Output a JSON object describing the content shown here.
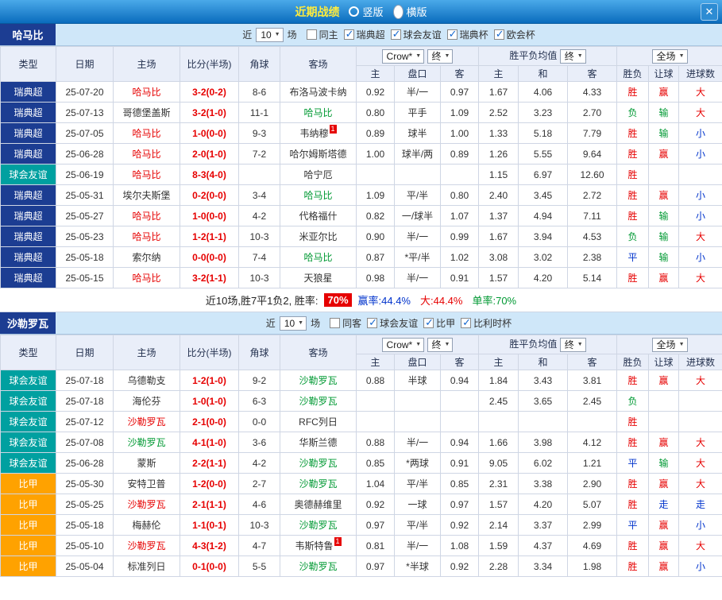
{
  "colors": {
    "red": "#e60000",
    "green": "#009933",
    "blue": "#0033cc",
    "black": "#333333",
    "league_sweden": "#1c3d92",
    "league_friendly": "#00a0a0",
    "league_belgium": "#ffa200"
  },
  "titlebar": {
    "title": "近期战绩",
    "layout_vertical": "竖版",
    "layout_horizontal": "横版",
    "close": "✕"
  },
  "filter_labels": {
    "near": "近",
    "unit": "场"
  },
  "columns": {
    "type": "类型",
    "date": "日期",
    "home": "主场",
    "score": "比分(半场)",
    "corner": "角球",
    "away": "客场",
    "odds_home": "主",
    "odds_line": "盘口",
    "odds_away": "客",
    "avg_home": "主",
    "avg_draw": "和",
    "avg_away": "客",
    "wdl": "胜负",
    "handicap": "让球",
    "goals": "进球数",
    "bookmaker": "Crow*",
    "final": "终",
    "avg_label": "胜平负均值",
    "scope": "全场"
  },
  "sections": [
    {
      "team": "哈马比",
      "filter": {
        "count": "10",
        "checkboxes": [
          {
            "label": "同主",
            "checked": false
          },
          {
            "label": "瑞典超",
            "checked": true
          },
          {
            "label": "球会友谊",
            "checked": true
          },
          {
            "label": "瑞典杯",
            "checked": true
          },
          {
            "label": "欧会杯",
            "checked": true
          }
        ]
      },
      "rows": [
        {
          "league": "瑞典超",
          "league_color": "league_sweden",
          "date": "25-07-20",
          "home": {
            "text": "哈马比",
            "color": "red"
          },
          "score": "3-2(0-2)",
          "corner": "8-6",
          "away": {
            "text": "布洛马波卡纳",
            "color": "black"
          },
          "odds": [
            "0.92",
            "半/一",
            "0.97"
          ],
          "avg": [
            "1.67",
            "4.06",
            "4.33"
          ],
          "results": [
            {
              "t": "胜",
              "c": "red"
            },
            {
              "t": "赢",
              "c": "red"
            },
            {
              "t": "大",
              "c": "red"
            }
          ]
        },
        {
          "league": "瑞典超",
          "league_color": "league_sweden",
          "date": "25-07-13",
          "home": {
            "text": "哥德堡盖斯",
            "color": "black"
          },
          "score": "3-2(1-0)",
          "corner": "11-1",
          "away": {
            "text": "哈马比",
            "color": "green"
          },
          "odds": [
            "0.80",
            "平手",
            "1.09"
          ],
          "avg": [
            "2.52",
            "3.23",
            "2.70"
          ],
          "results": [
            {
              "t": "负",
              "c": "green"
            },
            {
              "t": "输",
              "c": "green"
            },
            {
              "t": "大",
              "c": "red"
            }
          ]
        },
        {
          "league": "瑞典超",
          "league_color": "league_sweden",
          "date": "25-07-05",
          "home": {
            "text": "哈马比",
            "color": "red"
          },
          "score": "1-0(0-0)",
          "corner": "9-3",
          "away": {
            "text": "韦纳穆",
            "color": "black",
            "badge": "1"
          },
          "odds": [
            "0.89",
            "球半",
            "1.00"
          ],
          "avg": [
            "1.33",
            "5.18",
            "7.79"
          ],
          "results": [
            {
              "t": "胜",
              "c": "red"
            },
            {
              "t": "输",
              "c": "green"
            },
            {
              "t": "小",
              "c": "blue"
            }
          ]
        },
        {
          "league": "瑞典超",
          "league_color": "league_sweden",
          "date": "25-06-28",
          "home": {
            "text": "哈马比",
            "color": "red"
          },
          "score": "2-0(1-0)",
          "corner": "7-2",
          "away": {
            "text": "哈尔姆斯塔德",
            "color": "black"
          },
          "odds": [
            "1.00",
            "球半/两",
            "0.89"
          ],
          "avg": [
            "1.26",
            "5.55",
            "9.64"
          ],
          "results": [
            {
              "t": "胜",
              "c": "red"
            },
            {
              "t": "赢",
              "c": "red"
            },
            {
              "t": "小",
              "c": "blue"
            }
          ]
        },
        {
          "league": "球会友谊",
          "league_color": "league_friendly",
          "date": "25-06-19",
          "home": {
            "text": "哈马比",
            "color": "red"
          },
          "score": "8-3(4-0)",
          "corner": "",
          "away": {
            "text": "哈宁厄",
            "color": "black"
          },
          "odds": [
            "",
            "",
            ""
          ],
          "avg": [
            "1.15",
            "6.97",
            "12.60"
          ],
          "results": [
            {
              "t": "胜",
              "c": "red"
            },
            {
              "t": "",
              "c": "black"
            },
            {
              "t": "",
              "c": "black"
            }
          ]
        },
        {
          "league": "瑞典超",
          "league_color": "league_sweden",
          "date": "25-05-31",
          "home": {
            "text": "埃尔夫斯堡",
            "color": "black"
          },
          "score": "0-2(0-0)",
          "corner": "3-4",
          "away": {
            "text": "哈马比",
            "color": "green"
          },
          "odds": [
            "1.09",
            "平/半",
            "0.80"
          ],
          "avg": [
            "2.40",
            "3.45",
            "2.72"
          ],
          "results": [
            {
              "t": "胜",
              "c": "red"
            },
            {
              "t": "赢",
              "c": "red"
            },
            {
              "t": "小",
              "c": "blue"
            }
          ]
        },
        {
          "league": "瑞典超",
          "league_color": "league_sweden",
          "date": "25-05-27",
          "home": {
            "text": "哈马比",
            "color": "red"
          },
          "score": "1-0(0-0)",
          "corner": "4-2",
          "away": {
            "text": "代格福什",
            "color": "black"
          },
          "odds": [
            "0.82",
            "一/球半",
            "1.07"
          ],
          "avg": [
            "1.37",
            "4.94",
            "7.11"
          ],
          "results": [
            {
              "t": "胜",
              "c": "red"
            },
            {
              "t": "输",
              "c": "green"
            },
            {
              "t": "小",
              "c": "blue"
            }
          ]
        },
        {
          "league": "瑞典超",
          "league_color": "league_sweden",
          "date": "25-05-23",
          "home": {
            "text": "哈马比",
            "color": "red"
          },
          "score": "1-2(1-1)",
          "corner": "10-3",
          "away": {
            "text": "米亚尔比",
            "color": "black"
          },
          "odds": [
            "0.90",
            "半/一",
            "0.99"
          ],
          "avg": [
            "1.67",
            "3.94",
            "4.53"
          ],
          "results": [
            {
              "t": "负",
              "c": "green"
            },
            {
              "t": "输",
              "c": "green"
            },
            {
              "t": "大",
              "c": "red"
            }
          ]
        },
        {
          "league": "瑞典超",
          "league_color": "league_sweden",
          "date": "25-05-18",
          "home": {
            "text": "索尔纳",
            "color": "black"
          },
          "score": "0-0(0-0)",
          "corner": "7-4",
          "away": {
            "text": "哈马比",
            "color": "green"
          },
          "odds": [
            "0.87",
            "*平/半",
            "1.02"
          ],
          "avg": [
            "3.08",
            "3.02",
            "2.38"
          ],
          "results": [
            {
              "t": "平",
              "c": "blue"
            },
            {
              "t": "输",
              "c": "green"
            },
            {
              "t": "小",
              "c": "blue"
            }
          ]
        },
        {
          "league": "瑞典超",
          "league_color": "league_sweden",
          "date": "25-05-15",
          "home": {
            "text": "哈马比",
            "color": "red"
          },
          "score": "3-2(1-1)",
          "corner": "10-3",
          "away": {
            "text": "天狼星",
            "color": "black"
          },
          "odds": [
            "0.98",
            "半/一",
            "0.91"
          ],
          "avg": [
            "1.57",
            "4.20",
            "5.14"
          ],
          "results": [
            {
              "t": "胜",
              "c": "red"
            },
            {
              "t": "赢",
              "c": "red"
            },
            {
              "t": "大",
              "c": "red"
            }
          ]
        }
      ],
      "summary": {
        "prefix": "近10场,胜7平1负2, 胜率:",
        "rate": "70%",
        "stats": [
          {
            "text": "赢率:44.4%",
            "color": "blue"
          },
          {
            "text": "大:44.4%",
            "color": "red"
          },
          {
            "text": "单率:70%",
            "color": "green"
          }
        ]
      }
    },
    {
      "team": "沙勒罗瓦",
      "filter": {
        "count": "10",
        "checkboxes": [
          {
            "label": "同客",
            "checked": false
          },
          {
            "label": "球会友谊",
            "checked": true
          },
          {
            "label": "比甲",
            "checked": true
          },
          {
            "label": "比利时杯",
            "checked": true
          }
        ]
      },
      "rows": [
        {
          "league": "球会友谊",
          "league_color": "league_friendly",
          "date": "25-07-18",
          "home": {
            "text": "乌德勒支",
            "color": "black"
          },
          "score": "1-2(1-0)",
          "corner": "9-2",
          "away": {
            "text": "沙勒罗瓦",
            "color": "green"
          },
          "odds": [
            "0.88",
            "半球",
            "0.94"
          ],
          "avg": [
            "1.84",
            "3.43",
            "3.81"
          ],
          "results": [
            {
              "t": "胜",
              "c": "red"
            },
            {
              "t": "赢",
              "c": "red"
            },
            {
              "t": "大",
              "c": "red"
            }
          ]
        },
        {
          "league": "球会友谊",
          "league_color": "league_friendly",
          "date": "25-07-18",
          "home": {
            "text": "海伦芬",
            "color": "black"
          },
          "score": "1-0(1-0)",
          "corner": "6-3",
          "away": {
            "text": "沙勒罗瓦",
            "color": "green"
          },
          "odds": [
            "",
            "",
            ""
          ],
          "avg": [
            "2.45",
            "3.65",
            "2.45"
          ],
          "results": [
            {
              "t": "负",
              "c": "green"
            },
            {
              "t": "",
              "c": "black"
            },
            {
              "t": "",
              "c": "black"
            }
          ]
        },
        {
          "league": "球会友谊",
          "league_color": "league_friendly",
          "date": "25-07-12",
          "home": {
            "text": "沙勒罗瓦",
            "color": "red"
          },
          "score": "2-1(0-0)",
          "corner": "0-0",
          "away": {
            "text": "RFC列日",
            "color": "black"
          },
          "odds": [
            "",
            "",
            ""
          ],
          "avg": [
            "",
            "",
            ""
          ],
          "results": [
            {
              "t": "胜",
              "c": "red"
            },
            {
              "t": "",
              "c": "black"
            },
            {
              "t": "",
              "c": "black"
            }
          ]
        },
        {
          "league": "球会友谊",
          "league_color": "league_friendly",
          "date": "25-07-08",
          "home": {
            "text": "沙勒罗瓦",
            "color": "green"
          },
          "score": "4-1(1-0)",
          "corner": "3-6",
          "away": {
            "text": "华斯兰德",
            "color": "black"
          },
          "odds": [
            "0.88",
            "半/一",
            "0.94"
          ],
          "avg": [
            "1.66",
            "3.98",
            "4.12"
          ],
          "results": [
            {
              "t": "胜",
              "c": "red"
            },
            {
              "t": "赢",
              "c": "red"
            },
            {
              "t": "大",
              "c": "red"
            }
          ]
        },
        {
          "league": "球会友谊",
          "league_color": "league_friendly",
          "date": "25-06-28",
          "home": {
            "text": "蒙斯",
            "color": "black"
          },
          "score": "2-2(1-1)",
          "corner": "4-2",
          "away": {
            "text": "沙勒罗瓦",
            "color": "green"
          },
          "odds": [
            "0.85",
            "*两球",
            "0.91"
          ],
          "avg": [
            "9.05",
            "6.02",
            "1.21"
          ],
          "results": [
            {
              "t": "平",
              "c": "blue"
            },
            {
              "t": "输",
              "c": "green"
            },
            {
              "t": "大",
              "c": "red"
            }
          ]
        },
        {
          "league": "比甲",
          "league_color": "league_belgium",
          "date": "25-05-30",
          "home": {
            "text": "安特卫普",
            "color": "black"
          },
          "score": "1-2(0-0)",
          "corner": "2-7",
          "away": {
            "text": "沙勒罗瓦",
            "color": "green"
          },
          "odds": [
            "1.04",
            "平/半",
            "0.85"
          ],
          "avg": [
            "2.31",
            "3.38",
            "2.90"
          ],
          "results": [
            {
              "t": "胜",
              "c": "red"
            },
            {
              "t": "赢",
              "c": "red"
            },
            {
              "t": "大",
              "c": "red"
            }
          ]
        },
        {
          "league": "比甲",
          "league_color": "league_belgium",
          "date": "25-05-25",
          "home": {
            "text": "沙勒罗瓦",
            "color": "red"
          },
          "score": "2-1(1-1)",
          "corner": "4-6",
          "away": {
            "text": "奥德赫维里",
            "color": "black"
          },
          "odds": [
            "0.92",
            "一球",
            "0.97"
          ],
          "avg": [
            "1.57",
            "4.20",
            "5.07"
          ],
          "results": [
            {
              "t": "胜",
              "c": "red"
            },
            {
              "t": "走",
              "c": "blue"
            },
            {
              "t": "走",
              "c": "blue"
            }
          ]
        },
        {
          "league": "比甲",
          "league_color": "league_belgium",
          "date": "25-05-18",
          "home": {
            "text": "梅赫伦",
            "color": "black"
          },
          "score": "1-1(0-1)",
          "corner": "10-3",
          "away": {
            "text": "沙勒罗瓦",
            "color": "green"
          },
          "odds": [
            "0.97",
            "平/半",
            "0.92"
          ],
          "avg": [
            "2.14",
            "3.37",
            "2.99"
          ],
          "results": [
            {
              "t": "平",
              "c": "blue"
            },
            {
              "t": "赢",
              "c": "red"
            },
            {
              "t": "小",
              "c": "blue"
            }
          ]
        },
        {
          "league": "比甲",
          "league_color": "league_belgium",
          "date": "25-05-10",
          "home": {
            "text": "沙勒罗瓦",
            "color": "red"
          },
          "score": "4-3(1-2)",
          "corner": "4-7",
          "away": {
            "text": "韦斯特鲁",
            "color": "black",
            "badge": "1"
          },
          "odds": [
            "0.81",
            "半/一",
            "1.08"
          ],
          "avg": [
            "1.59",
            "4.37",
            "4.69"
          ],
          "results": [
            {
              "t": "胜",
              "c": "red"
            },
            {
              "t": "赢",
              "c": "red"
            },
            {
              "t": "大",
              "c": "red"
            }
          ]
        },
        {
          "league": "比甲",
          "league_color": "league_belgium",
          "date": "25-05-04",
          "home": {
            "text": "标准列日",
            "color": "black"
          },
          "score": "0-1(0-0)",
          "corner": "5-5",
          "away": {
            "text": "沙勒罗瓦",
            "color": "green"
          },
          "odds": [
            "0.97",
            "*半球",
            "0.92"
          ],
          "avg": [
            "2.28",
            "3.34",
            "1.98"
          ],
          "results": [
            {
              "t": "胜",
              "c": "red"
            },
            {
              "t": "赢",
              "c": "red"
            },
            {
              "t": "小",
              "c": "blue"
            }
          ]
        }
      ]
    }
  ]
}
